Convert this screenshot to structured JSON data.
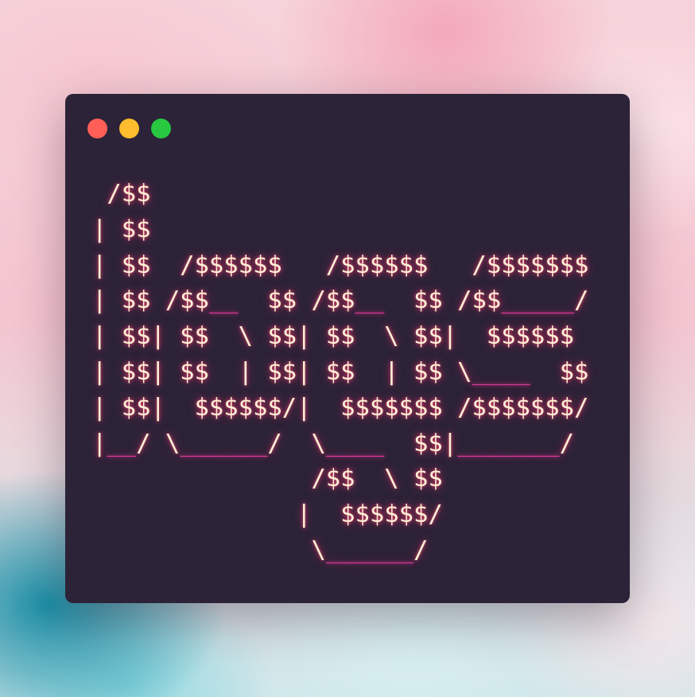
{
  "window": {
    "controls": [
      {
        "name": "close",
        "color": "#ff5f57"
      },
      {
        "name": "minimize",
        "color": "#febc2e"
      },
      {
        "name": "maximize",
        "color": "#28c840"
      }
    ],
    "background_color": "#2c2338",
    "text_color": "#fff0d6",
    "underscore_color": "#e0399b",
    "glow_color": "#ff2a6e"
  },
  "ascii_art": [
    " /$$",
    "| $$",
    "| $$  /$$$$$$   /$$$$$$   /$$$$$$$",
    "| $$ /$$__  $$ /$$__  $$ /$$_____/",
    "| $$| $$  \\ $$| $$  \\ $$|  $$$$$$",
    "| $$| $$  | $$| $$  | $$ \\____  $$",
    "| $$|  $$$$$$/|  $$$$$$$ /$$$$$$$/",
    "|__/ \\______/  \\____  $$|_______/",
    "               /$$  \\ $$",
    "              |  $$$$$$/",
    "               \\______/"
  ]
}
